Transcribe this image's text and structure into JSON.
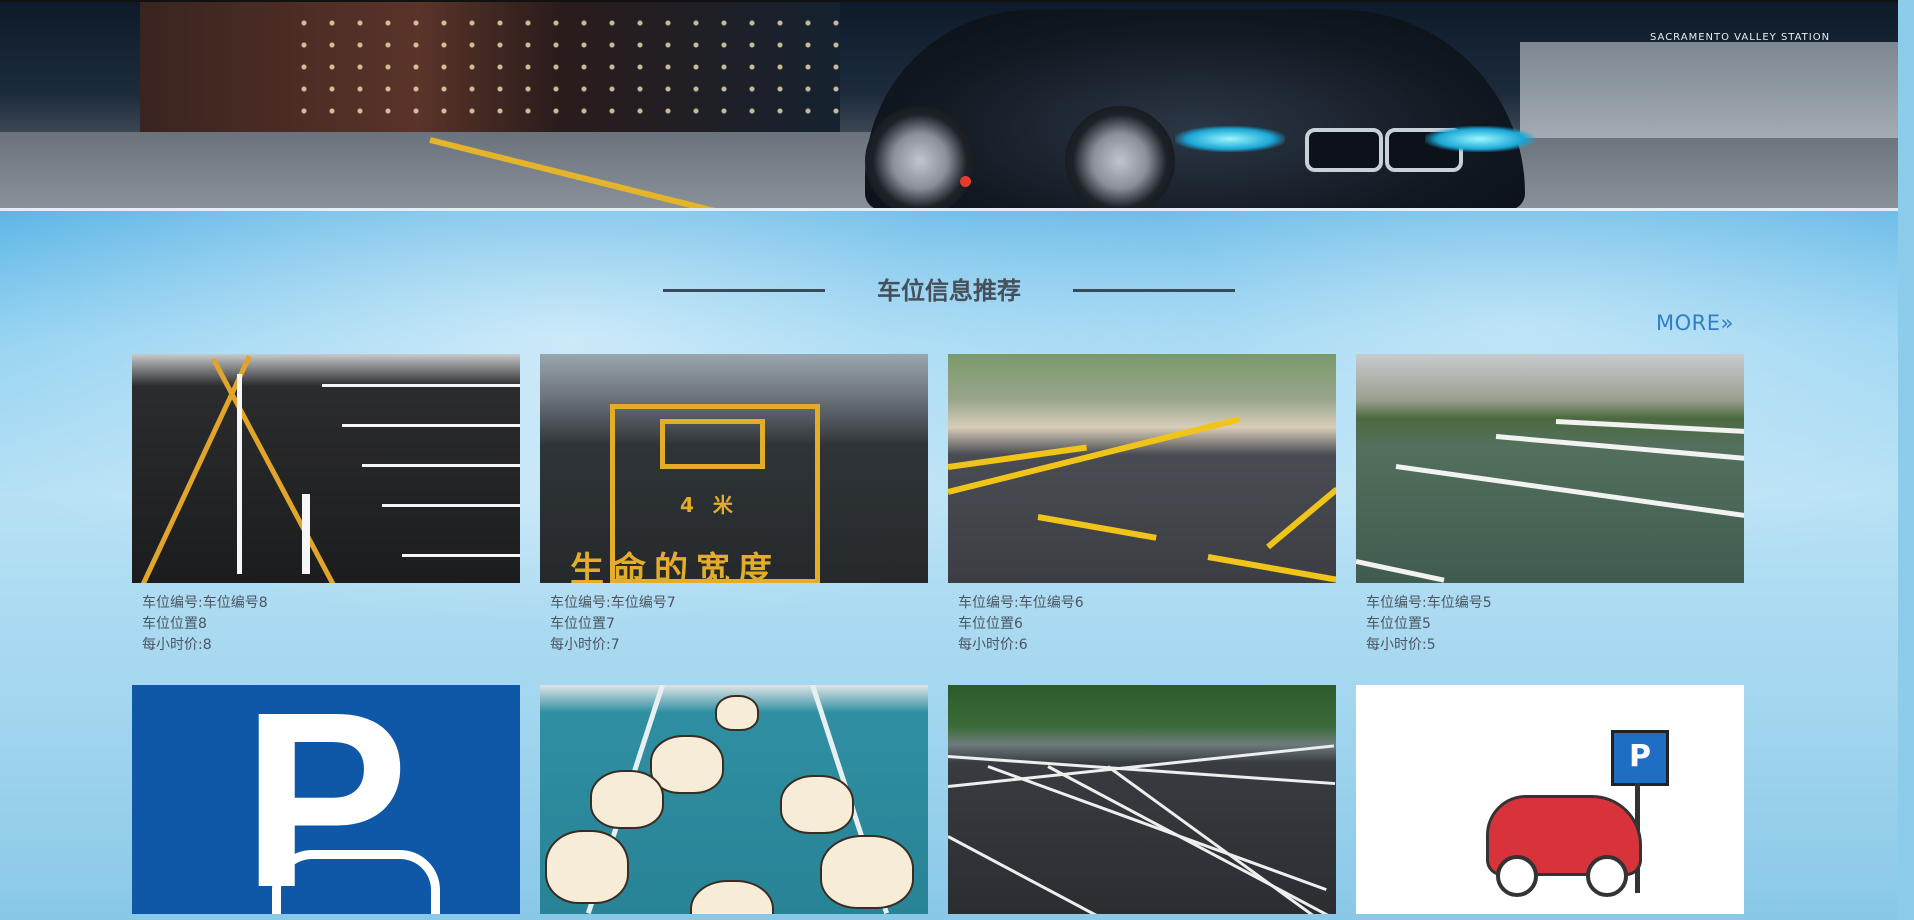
{
  "banner": {
    "station_sign": "SACRAMENTO VALLEY STATION",
    "carousel_dots": 1
  },
  "section": {
    "title": "车位信息推荐",
    "more_label": "MORE»"
  },
  "spots": [
    {
      "number": "车位编号:车位编号8",
      "location": "车位位置8",
      "price": "每小时价:8"
    },
    {
      "number": "车位编号:车位编号7",
      "location": "车位位置7",
      "price": "每小时价:7"
    },
    {
      "number": "车位编号:车位编号6",
      "location": "车位位置6",
      "price": "每小时价:6"
    },
    {
      "number": "车位编号:车位编号5",
      "location": "车位位置5",
      "price": "每小时价:5"
    }
  ],
  "image_text": {
    "width_slogan": "生命的宽度",
    "width_measure": "4 米",
    "parking_letter": "P"
  },
  "colors": {
    "accent": "#2f7fc4",
    "carousel_active": "#e83b2f",
    "title_text": "#45505a"
  }
}
